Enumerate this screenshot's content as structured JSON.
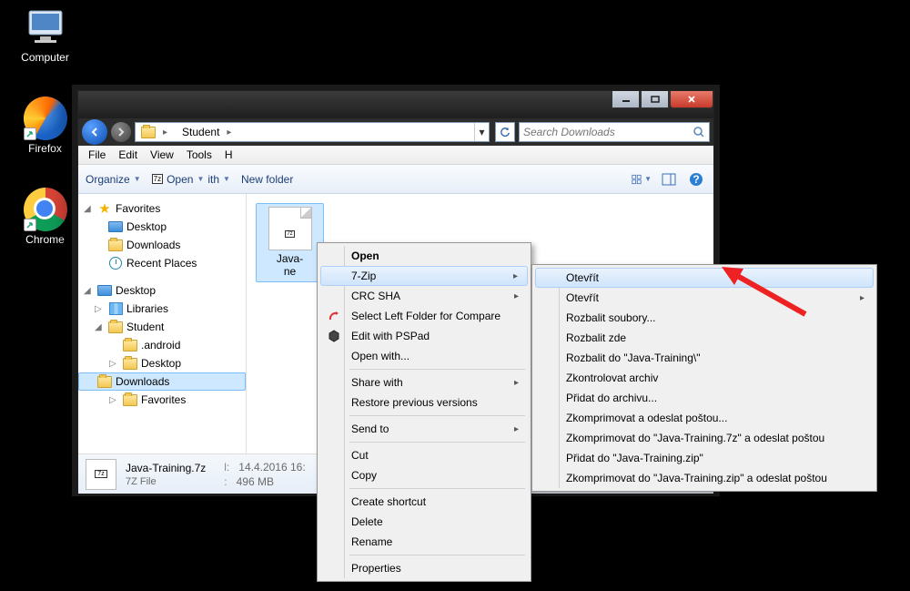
{
  "desktop": {
    "computer": "Computer",
    "firefox": "Firefox",
    "chrome": "Chrome"
  },
  "window": {
    "breadcrumb": {
      "seg1": "Student"
    },
    "search_placeholder": "Search Downloads",
    "menubar": {
      "file": "File",
      "edit": "Edit",
      "view": "View",
      "tools": "Tools",
      "help": "H"
    },
    "toolbar": {
      "organize": "Organize",
      "open": "Open",
      "open_with_suffix": "ith",
      "newfolder": "New folder"
    },
    "nav": {
      "favorites": "Favorites",
      "fav_desktop": "Desktop",
      "fav_downloads": "Downloads",
      "fav_recent": "Recent Places",
      "desktop_root": "Desktop",
      "libraries": "Libraries",
      "student": "Student",
      "android": ".android",
      "u_desktop": "Desktop",
      "u_downloads": "Downloads",
      "u_favorites": "Favorites"
    },
    "file": {
      "name": "Java-",
      "name2": "ne"
    },
    "details": {
      "name": "Java-Training.7z",
      "type": "7Z File",
      "date_label": "l:",
      "date": "14.4.2016 16:",
      "size_label": ":",
      "size": "496 MB"
    }
  },
  "ctx1": {
    "open": "Open",
    "sevenzip": "7-Zip",
    "crc": "CRC SHA",
    "selleft": "Select Left Folder for Compare",
    "pspad": "Edit with PSPad",
    "openwith": "Open with...",
    "sharewith": "Share with",
    "restore": "Restore previous versions",
    "sendto": "Send to",
    "cut": "Cut",
    "copy": "Copy",
    "shortcut": "Create shortcut",
    "delete": "Delete",
    "rename": "Rename",
    "properties": "Properties"
  },
  "ctx2": {
    "otevrit1": "Otevřít",
    "otevrit2": "Otevřít",
    "rozbalit_soubory": "Rozbalit soubory...",
    "rozbalit_zde": "Rozbalit zde",
    "rozbalit_do": "Rozbalit do \"Java-Training\\\"",
    "zkontrolovat": "Zkontrolovat archiv",
    "pridat_archivu": "Přidat do archivu...",
    "zkomp_posta": "Zkomprimovat a odeslat poštou...",
    "zkomp_7z": "Zkomprimovat do \"Java-Training.7z\" a odeslat poštou",
    "pridat_zip": "Přidat do \"Java-Training.zip\"",
    "zkomp_zip": "Zkomprimovat do \"Java-Training.zip\" a odeslat poštou"
  }
}
